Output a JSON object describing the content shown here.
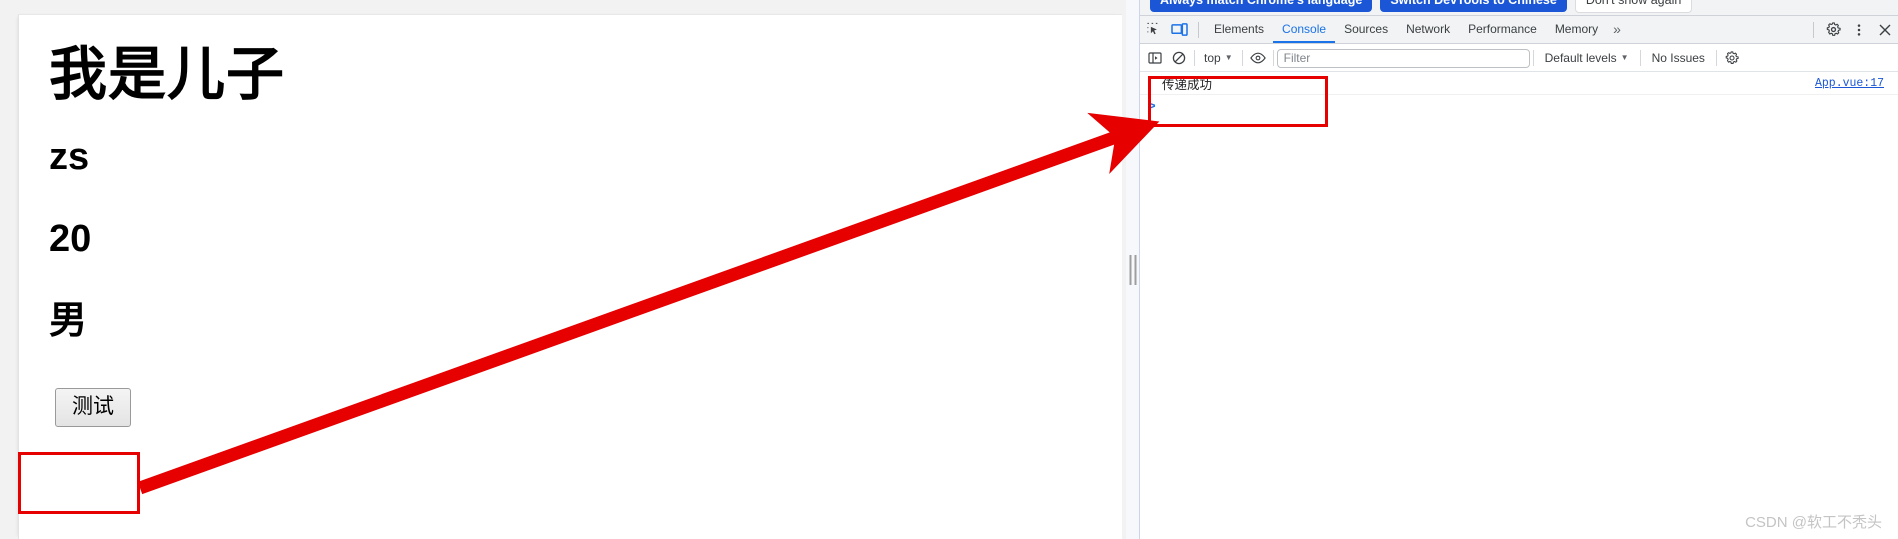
{
  "webpage": {
    "heading": "我是儿子",
    "name": "zs",
    "age": "20",
    "gender": "男",
    "button_label": "测试"
  },
  "devtools": {
    "language_banner": {
      "match_language_label": "Always match Chrome's language",
      "switch_label": "Switch DevTools to Chinese",
      "dismiss_label": "Don't show again"
    },
    "icons": {
      "inspect": "inspect-element-icon",
      "device_toolbar": "device-toggle-icon",
      "sidebar_toggle": "console-sidebar-icon",
      "clear_console": "clear-console-icon",
      "eye": "live-expression-icon",
      "settings": "gear-icon",
      "more": "kebab-menu-icon",
      "close": "close-icon"
    },
    "tabs": [
      {
        "label": "Elements",
        "active": false
      },
      {
        "label": "Console",
        "active": true
      },
      {
        "label": "Sources",
        "active": false
      },
      {
        "label": "Network",
        "active": false
      },
      {
        "label": "Performance",
        "active": false
      },
      {
        "label": "Memory",
        "active": false
      }
    ],
    "tabs_overflow_label": "»",
    "console_toolbar": {
      "context": "top",
      "filter_placeholder": "Filter",
      "filter_value": "",
      "levels_label": "Default levels",
      "issues_label": "No Issues"
    },
    "console_messages": [
      {
        "text": "传递成功",
        "source": "App.vue:17"
      }
    ],
    "prompt": ">"
  },
  "watermark": "CSDN @软工不秃头",
  "colors": {
    "accent_blue": "#1a73e8",
    "banner_blue": "#1a56d6",
    "annotation_red": "#e60000",
    "toolbar_bg": "#f1f3f4"
  }
}
